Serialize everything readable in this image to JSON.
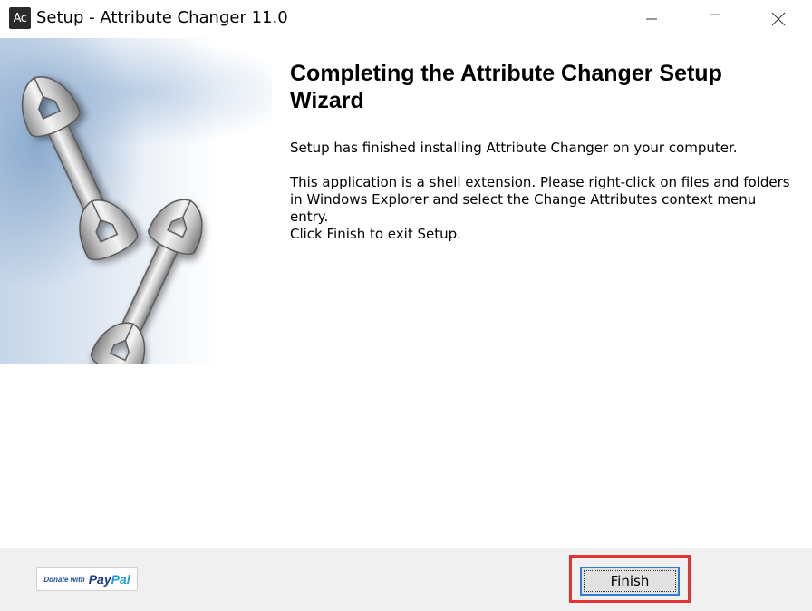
{
  "window": {
    "app_icon_text": "Ac",
    "title": "Setup - Attribute Changer 11.0",
    "controls": {
      "minimize_icon": "minimize-icon",
      "maximize_icon": "maximize-icon",
      "close_icon": "close-icon"
    }
  },
  "banner": {
    "image": "wrenches-illustration"
  },
  "wizard": {
    "title": "Completing the Attribute Changer Setup Wizard",
    "paragraphs": [
      "Setup has finished installing Attribute Changer on your computer.",
      "This application is a shell extension. Please right-click on files and folders in Windows Explorer and select the Change Attributes context menu entry.",
      "Click Finish to exit Setup."
    ]
  },
  "footer": {
    "paypal": {
      "donate_text": "Donate with",
      "pay": "Pay",
      "pal": "Pal"
    },
    "finish_label": "Finish"
  },
  "colors": {
    "highlight": "#e53333",
    "button_focus": "#2f7fd0",
    "footer_bg": "#f0f0f0",
    "paypal_dark": "#1e3a8a",
    "paypal_light": "#1e9bd7"
  }
}
